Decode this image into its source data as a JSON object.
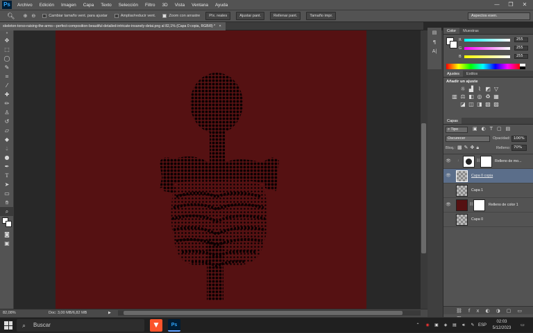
{
  "app": {
    "logo": "Ps"
  },
  "menubar": {
    "items": [
      "Archivo",
      "Edición",
      "Imagen",
      "Capa",
      "Texto",
      "Selección",
      "Filtro",
      "3D",
      "Vista",
      "Ventana",
      "Ayuda"
    ],
    "window_controls": [
      "—",
      "❐",
      "✕"
    ]
  },
  "options": {
    "tool_icon": "zoom-icon",
    "checkbox1_label": "Cambiar tamaño vent. para ajustar",
    "checkbox1_checked": false,
    "checkbox2_label": "Ampliar/reducir vent.",
    "checkbox2_checked": false,
    "checkbox3_label": "Zoom con arrastre",
    "checkbox3_checked": true,
    "btn_actual": "Píx. reales",
    "btn_fit": "Ajustar pant.",
    "btn_fill": "Rellenar pant.",
    "btn_print": "Tamaño impr.",
    "workspace": "Aspectos esen."
  },
  "document": {
    "tab_title": "skeleton-torso-raising-the-arms---perfect-composition-beautiful-detailed-intricate-insanely-detai.png al 82,1% (Capa 0 copia, RGB/8) *",
    "tab_close": "×",
    "background_color": "#551112"
  },
  "status": {
    "zoom": "82,08%",
    "doc_info": "Doc: 3,00 MB/6,82 MB"
  },
  "color_panel": {
    "tabs": [
      "Color",
      "Muestras"
    ],
    "r": "255",
    "g": "255",
    "b": "255",
    "labels": [
      "R",
      "G",
      "B"
    ]
  },
  "adjustments_panel": {
    "tabs": [
      "Ajustes",
      "Estilos"
    ],
    "title": "Añadir un ajuste"
  },
  "layers_panel": {
    "tabs": [
      "Capas"
    ],
    "filter_kind": "Tipo",
    "blend_mode": "Oscurecer",
    "opacity_label": "Opacidad:",
    "opacity": "100%",
    "lock_label": "Bloq.:",
    "fill_label": "Relleno:",
    "fill": "70%",
    "layers": [
      {
        "name": "Relleno de mo...",
        "visible": true,
        "selected": false
      },
      {
        "name": "Capa 0 copia",
        "visible": true,
        "selected": true
      },
      {
        "name": "Capa 1",
        "visible": false,
        "selected": false
      },
      {
        "name": "Relleno de color 1",
        "visible": true,
        "selected": false
      },
      {
        "name": "Capa 0",
        "visible": false,
        "selected": false
      }
    ]
  },
  "taskbar": {
    "search_placeholder": "Buscar",
    "language": "ESP",
    "time": "02:03",
    "date": "5/12/2023"
  }
}
